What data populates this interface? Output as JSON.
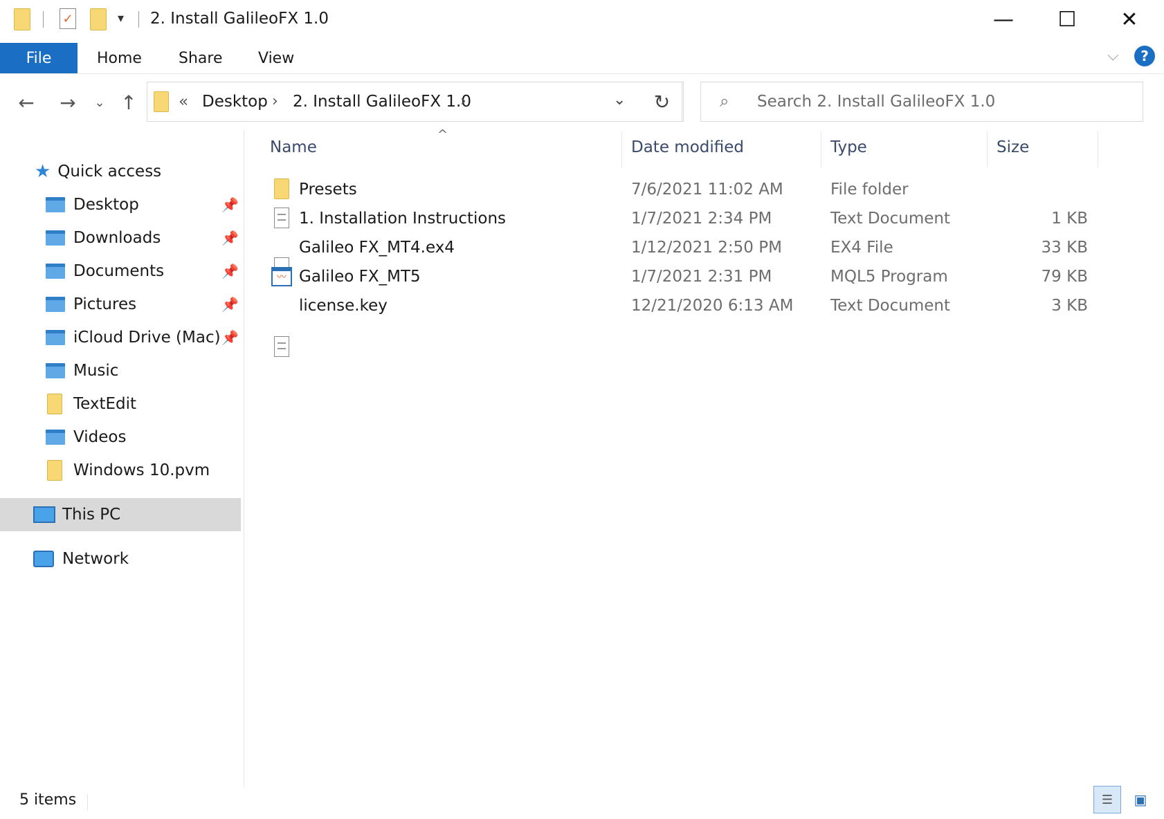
{
  "window": {
    "title": "2. Install GalileoFX 1.0",
    "minimize_glyph": "—",
    "maximize_glyph": "☐",
    "close_glyph": "✕"
  },
  "ribbon": {
    "tabs": [
      "File",
      "Home",
      "Share",
      "View"
    ],
    "help_glyph": "?"
  },
  "address_bar": {
    "overflow_glyph": "«",
    "crumbs": [
      "Desktop",
      "2. Install GalileoFX 1.0"
    ],
    "separator": "›"
  },
  "search": {
    "placeholder": "Search 2. Install GalileoFX 1.0"
  },
  "sidebar": {
    "quick_access": "Quick access",
    "items": [
      {
        "label": "Desktop",
        "icon": "desktop-library-icon",
        "pinned": true
      },
      {
        "label": "Downloads",
        "icon": "downloads-library-icon",
        "pinned": true
      },
      {
        "label": "Documents",
        "icon": "documents-library-icon",
        "pinned": true
      },
      {
        "label": "Pictures",
        "icon": "pictures-library-icon",
        "pinned": true
      },
      {
        "label": "iCloud Drive (Mac)",
        "icon": "icloud-library-icon",
        "pinned": true
      },
      {
        "label": "Music",
        "icon": "music-library-icon",
        "pinned": false
      },
      {
        "label": "TextEdit",
        "icon": "folder-icon",
        "pinned": false
      },
      {
        "label": "Videos",
        "icon": "videos-library-icon",
        "pinned": false
      },
      {
        "label": "Windows 10.pvm",
        "icon": "folder-icon",
        "pinned": false
      }
    ],
    "this_pc": "This PC",
    "network": "Network"
  },
  "file_list": {
    "columns": [
      "Name",
      "Date modified",
      "Type",
      "Size"
    ],
    "rows": [
      {
        "name": "Presets",
        "date": "7/6/2021 11:02 AM",
        "type": "File folder",
        "size": "",
        "icon": "folder-icon"
      },
      {
        "name": "1. Installation Instructions",
        "date": "1/7/2021 2:34 PM",
        "type": "Text Document",
        "size": "1 KB",
        "icon": "text-document-icon"
      },
      {
        "name": "Galileo FX_MT4.ex4",
        "date": "1/12/2021 2:50 PM",
        "type": "EX4 File",
        "size": "33 KB",
        "icon": "generic-file-icon"
      },
      {
        "name": "Galileo FX_MT5",
        "date": "1/7/2021 2:31 PM",
        "type": "MQL5 Program",
        "size": "79 KB",
        "icon": "mql5-program-icon"
      },
      {
        "name": "license.key",
        "date": "12/21/2020 6:13 AM",
        "type": "Text Document",
        "size": "3 KB",
        "icon": "text-document-icon"
      }
    ]
  },
  "status_bar": {
    "item_count": "5 items"
  },
  "colors": {
    "accent": "#1a6fc4",
    "folder": "#f8d775",
    "selection": "#d9d9d9"
  }
}
